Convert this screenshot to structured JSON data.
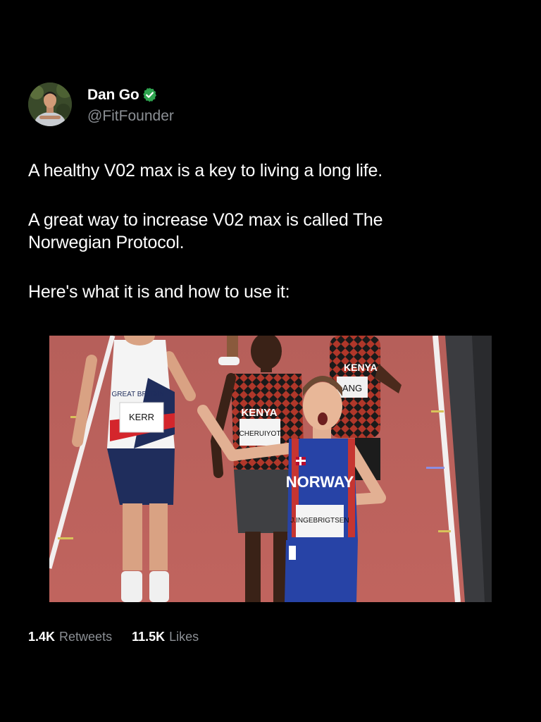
{
  "author": {
    "display_name": "Dan Go",
    "handle": "@FitFounder",
    "verified": true,
    "verified_color": "#2ea44f",
    "avatar_icon": "profile-photo"
  },
  "tweet": {
    "paragraphs": [
      "A healthy V02 max is a key to living a long life.",
      "A great way to increase V02 max is called The Norwegian Protocol.",
      "Here's what it is and how to use it:"
    ]
  },
  "media": {
    "bibs": {
      "kerr": "KERR",
      "great_britain": "GREAT BRITAIN",
      "kenya_front": "KENYA",
      "cheruiyot": "CHERUIYOT",
      "kenya_back": "KENYA",
      "kenya_back_bib": "ANG",
      "norway": "NORWAY",
      "ingebrigtsen": "J.INGEBRIGTSEN"
    }
  },
  "stats": {
    "retweets_count": "1.4K",
    "retweets_label": "Retweets",
    "likes_count": "11.5K",
    "likes_label": "Likes"
  },
  "colors": {
    "background": "#000000",
    "text": "#ffffff",
    "muted": "#8b8f94"
  }
}
